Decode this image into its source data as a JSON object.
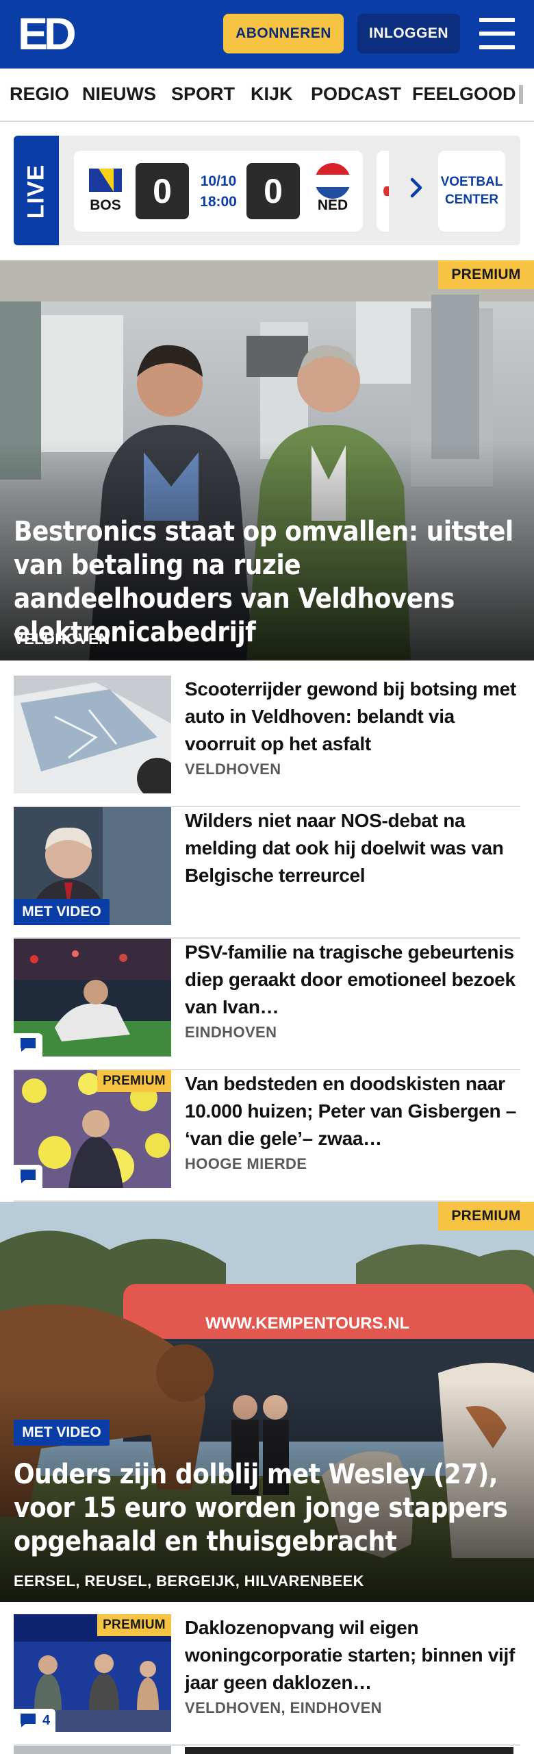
{
  "header": {
    "logo_text": "ED",
    "subscribe_label": "ABONNEREN",
    "login_label": "INLOGGEN",
    "menu_icon": "hamburger-menu-icon",
    "brand_color": "#0a3ea6",
    "accent_color": "#f6c343"
  },
  "nav": {
    "items": [
      "REGIO",
      "NIEUWS",
      "SPORT",
      "KIJK",
      "PODCAST",
      "FEELGOOD"
    ]
  },
  "live": {
    "label": "LIVE",
    "match": {
      "home_team": "BOS",
      "home_score": "0",
      "date": "10/10",
      "time": "18:00",
      "away_score": "0",
      "away_team": "NED"
    },
    "next_icon": "chevron-right-icon",
    "voetbal_center_line1": "VOETBAL",
    "voetbal_center_line2": "CENTER"
  },
  "premium_label": "PREMIUM",
  "video_label": "MET VIDEO",
  "lead": {
    "title": "Bestronics staat op omvallen: uitstel van betaling na ruzie aandeelhouders van Veldhovens elektronicabedrijf",
    "location": "VELDHOVEN"
  },
  "articles": [
    {
      "title": "Scooterrijder gewond bij botsing met auto in Veldhoven: belandt via voorruit op het asfalt",
      "location": "VELDHOVEN"
    },
    {
      "title": "Wilders niet naar NOS-debat na melding dat ook hij doelwit was van Belgische terreurcel",
      "location": ""
    },
    {
      "title": "PSV-familie na tragische gebeurtenis diep geraakt door emotioneel bezoek van Ivan…",
      "location": "EINDHOVEN"
    },
    {
      "title": "Van bedsteden en doodskisten naar 10.000 huizen; Peter van Gisbergen – ‘van die gele’– zwaa…",
      "location": "HOOGE MIERDE"
    }
  ],
  "feature": {
    "title": "Ouders zijn dolblij met Wesley (27), voor 15 euro worden jonge stappers opgehaald en thuisgebracht",
    "location": "EERSEL, REUSEL, BERGEIJK, HILVARENBEEK",
    "bus_text": "WWW.KEMPENTOURS.NL"
  },
  "article_last": {
    "title": "Daklozenopvang wil eigen woningcorporatie starten; binnen vijf jaar geen daklozen…",
    "location": "VELDHOVEN, EINDHOVEN",
    "comments": "4"
  }
}
